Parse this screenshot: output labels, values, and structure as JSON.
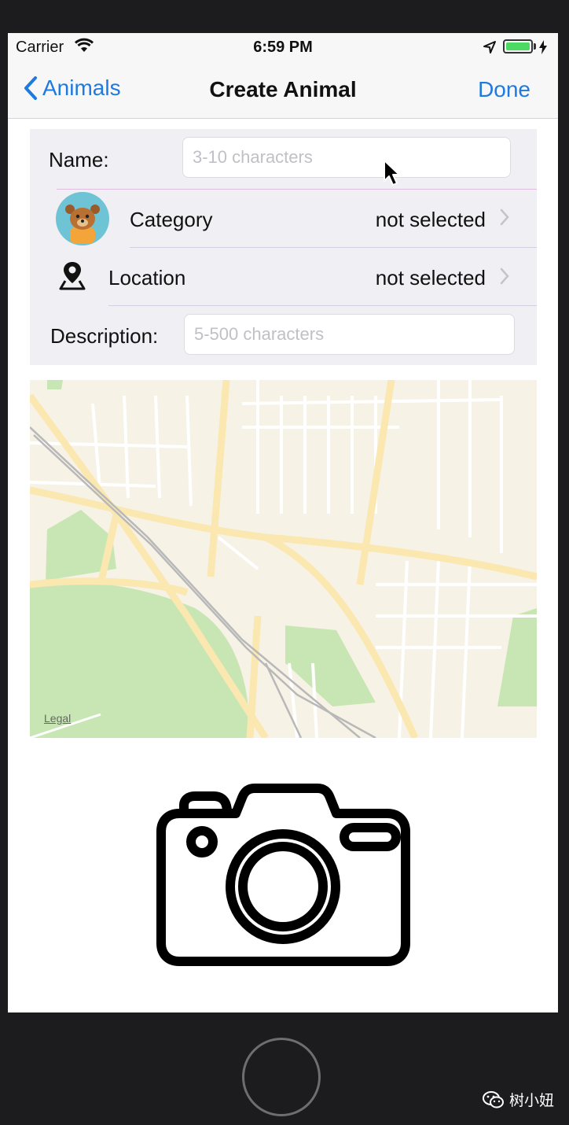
{
  "status_bar": {
    "carrier": "Carrier",
    "time": "6:59 PM",
    "battery_level": 1.0,
    "icons": [
      "wifi-icon",
      "location-arrow-icon",
      "battery-icon",
      "charging-bolt-icon"
    ]
  },
  "nav": {
    "back_label": "Animals",
    "title": "Create Animal",
    "done_label": "Done"
  },
  "form": {
    "name_label": "Name:",
    "name_value": "",
    "name_placeholder": "3-10 characters",
    "category_label": "Category",
    "category_value": "not selected",
    "category_icon": "bear-avatar-icon",
    "location_label": "Location",
    "location_value": "not selected",
    "location_icon": "map-pin-icon",
    "description_label": "Description:",
    "description_value": "",
    "description_placeholder": "5-500 characters"
  },
  "map": {
    "legal_label": "Legal"
  },
  "photo": {
    "icon": "camera-icon"
  },
  "watermark": {
    "text": "树小妞",
    "icon": "wechat-icon"
  },
  "colors": {
    "accent": "#1f7ae0",
    "form_background": "#efeff4",
    "map_park": "#c8e6b4",
    "map_road": "#fbe7b0"
  }
}
